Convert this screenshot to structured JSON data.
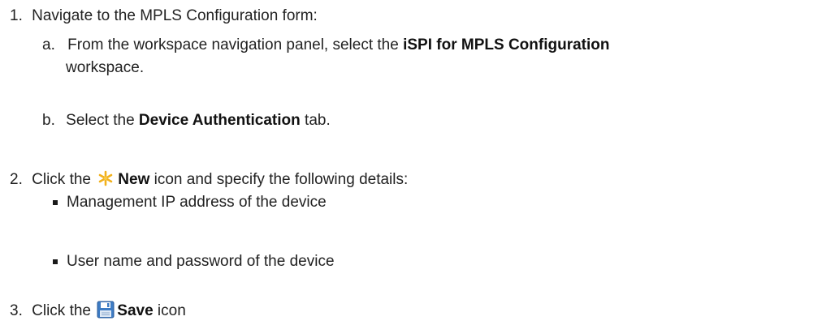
{
  "steps": [
    {
      "number": "1.",
      "text": "Navigate to the MPLS Configuration form:",
      "substeps": [
        {
          "letter": "a.",
          "prefix": "From the workspace navigation panel, select the ",
          "bold": "iSPI for MPLS Configuration",
          "suffix": "workspace."
        },
        {
          "letter": "b.",
          "prefix": "Select the ",
          "bold": "Device Authentication",
          "suffix": " tab."
        }
      ]
    },
    {
      "number": "2.",
      "prefix": "Click the ",
      "icon": "new-star-icon",
      "bold": "New",
      "suffix": " icon and specify the following details:",
      "bullets": [
        "Management IP address of the device",
        "User name and password of the device"
      ]
    },
    {
      "number": "3.",
      "prefix": "Click the ",
      "icon": "save-floppy-icon",
      "bold": "Save",
      "suffix": " icon"
    }
  ]
}
